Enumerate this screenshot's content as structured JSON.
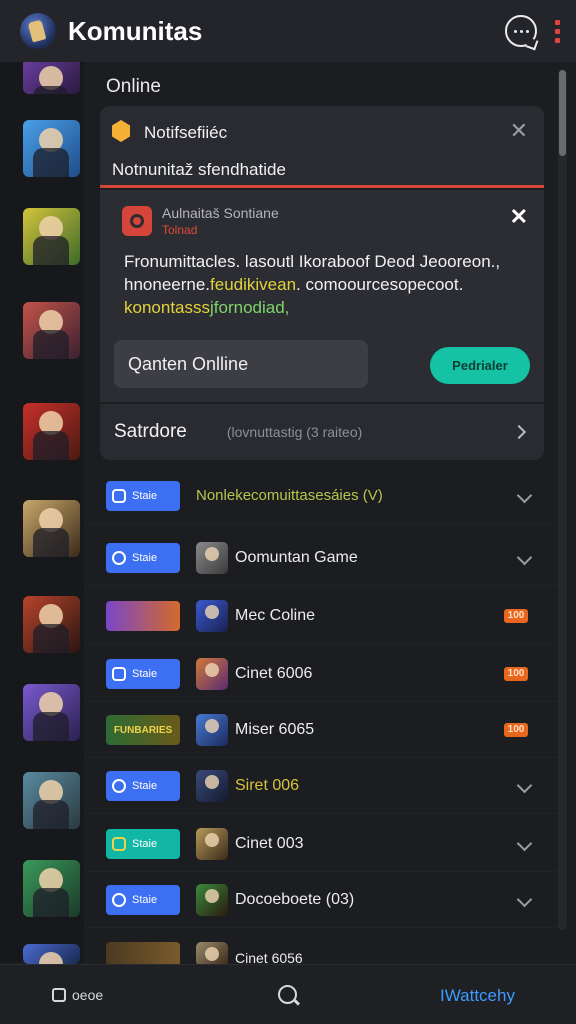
{
  "header": {
    "title": "Komunitas",
    "logo_icon": "game-logo-icon",
    "chat_icon": "chat-bubble-icon",
    "menu_icon": "kebab-menu-icon",
    "accent": "#e0443a"
  },
  "main": {
    "online_label": "Online"
  },
  "notification": {
    "title": "Notifsefiiéc",
    "subtitle": "Notnunitaž sfendhatide",
    "icon": "shield-icon"
  },
  "sheet": {
    "title": "Aulnaitaš Sontiane",
    "subtitle": "Tolnad",
    "body_line1": "Fronumittacles. lasoutl Ikoraboof Deod Jeooreon.,",
    "body_line2a": "hnoneerne.",
    "body_line2b": "feudikivean",
    "body_line2c": ". comoourcesopecoot.",
    "body_line3a": "konontasss",
    "body_line3b": "jfornodiad,",
    "input_value": "Qanten Onlline",
    "button_label": "Pedrialer",
    "accent": "#15c2a4"
  },
  "section": {
    "title": "Satrdore",
    "meta": "(lovnuttastig (3 raiteo)"
  },
  "list": [
    {
      "pill": "Staie",
      "pill_color": "#3d6ff2",
      "title": "Nonlekecomuittasesáies (V)",
      "trail": "chevron"
    },
    {
      "pill": "Staie",
      "pill_color": "#3d6ff2",
      "title": "Oomuntan Game",
      "trail": "chevron"
    },
    {
      "pill": "",
      "pill_color": "#7a46c8",
      "title": "Mec Coline",
      "trail": "badge",
      "badge": "100"
    },
    {
      "pill": "Staie",
      "pill_color": "#3d6ff2",
      "title": "Cinet 6006",
      "trail": "badge",
      "badge": "100"
    },
    {
      "pill": "FUNBARIES",
      "pill_color": "#2c6b34",
      "title": "Miser 6065",
      "trail": "badge",
      "badge": "100"
    },
    {
      "pill": "Staie",
      "pill_color": "#3d6ff2",
      "title": "Siret 006",
      "trail": "chevron"
    },
    {
      "pill": "Staie",
      "pill_color": "#12b6a6",
      "title": "Cinet 003",
      "trail": "chevron"
    },
    {
      "pill": "Staie",
      "pill_color": "#3d6ff2",
      "title": "Docoeboete (03)",
      "trail": "chevron"
    },
    {
      "pill": "",
      "pill_color": "#4a3a22",
      "title": "Cinet 6056",
      "trail": "none"
    }
  ],
  "bottom_nav": {
    "left_label": "oeoe",
    "right_label": "IWattcehy",
    "search_icon": "search-icon",
    "active_color": "#3d9bff"
  }
}
